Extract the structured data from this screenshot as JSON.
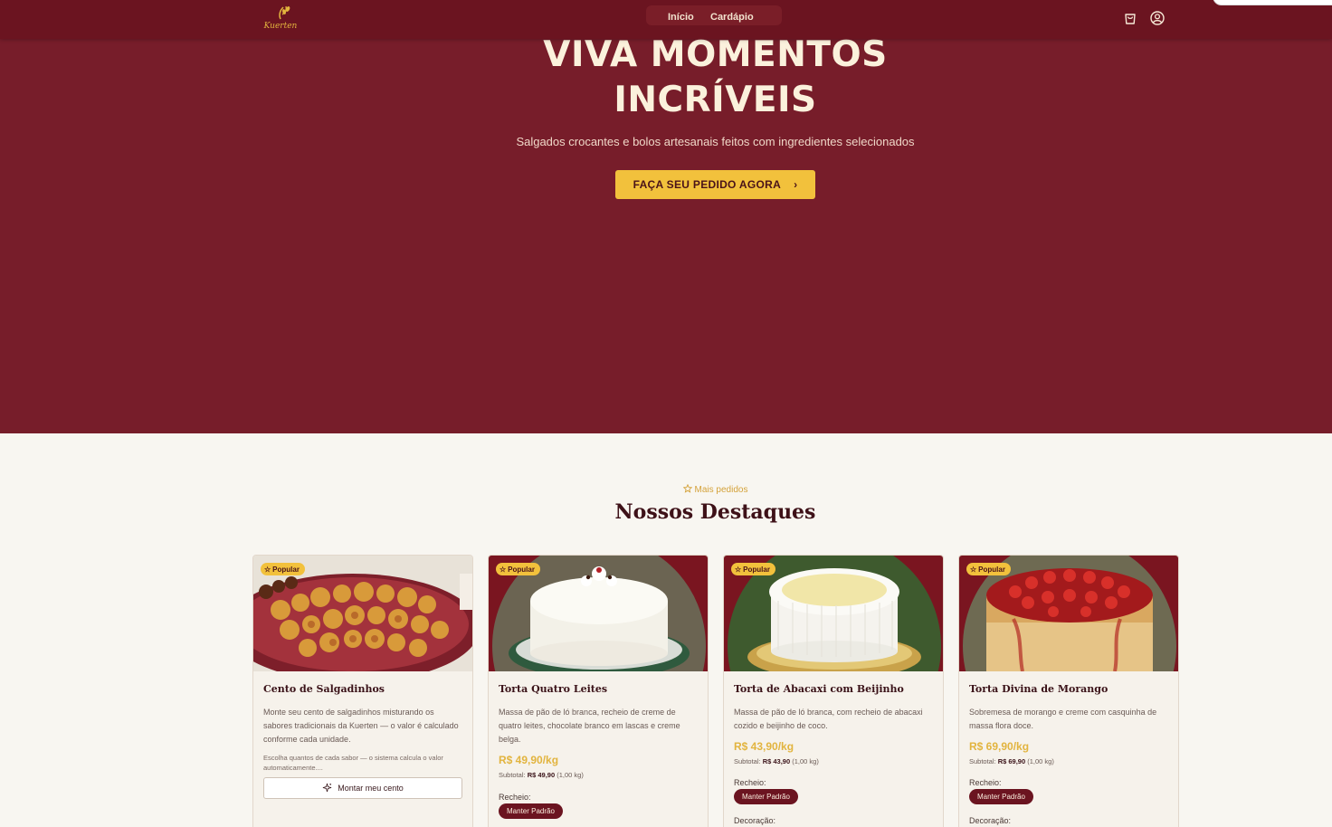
{
  "header": {
    "logo_text": "Kuerten",
    "nav": [
      "Início",
      "Cardápio"
    ]
  },
  "hero": {
    "title_line1": "VIVA MOMENTOS",
    "title_line2": "INCRÍVEIS",
    "subtitle": "Salgados crocantes e bolos artesanais feitos com ingredientes selecionados",
    "cta": "FAÇA SEU PEDIDO AGORA",
    "cta_chevron": "›"
  },
  "highlights": {
    "tag": "Mais pedidos",
    "title": "Nossos Destaques",
    "badge": "Popular",
    "cards": [
      {
        "name": "Cento de Salgadinhos",
        "description": "Monte seu cento de salgadinhos misturando os sabores tradicionais da Kuerten — o valor é calculado conforme cada unidade.",
        "note": "Escolha quantos de cada sabor — o sistema calcula o valor automaticamente....",
        "button": "Montar meu cento"
      },
      {
        "name": "Torta Quatro Leites",
        "description": "Massa de pão de ló branca, recheio de creme de quatro leites, chocolate branco em lascas e creme belga.",
        "price": "R$ 49,90/kg",
        "subtotal_label": "Subtotal:",
        "subtotal_value": "R$ 49,90",
        "subtotal_qty": "(1,00 kg)",
        "filling_label": "Recheio:",
        "filling_option": "Manter Padrão"
      },
      {
        "name": "Torta de Abacaxi com Beijinho",
        "description": "Massa de pão de ló branca, com recheio de abacaxi cozido e beijinho de coco.",
        "price": "R$ 43,90/kg",
        "subtotal_label": "Subtotal:",
        "subtotal_value": "R$ 43,90",
        "subtotal_qty": "(1,00 kg)",
        "filling_label": "Recheio:",
        "filling_option": "Manter Padrão",
        "decoration_label": "Decoração:"
      },
      {
        "name": "Torta Divina de Morango",
        "description": "Sobremesa de morango e creme com casquinha de massa flora doce.",
        "price": "R$ 69,90/kg",
        "subtotal_label": "Subtotal:",
        "subtotal_value": "R$ 69,90",
        "subtotal_qty": "(1,00 kg)",
        "filling_label": "Recheio:",
        "filling_option": "Manter Padrão",
        "decoration_label": "Decoração:"
      }
    ]
  },
  "colors": {
    "header": "#6b1420",
    "hero": "#771d2a",
    "accent": "#f2c13c",
    "background": "#f8f6f1"
  }
}
